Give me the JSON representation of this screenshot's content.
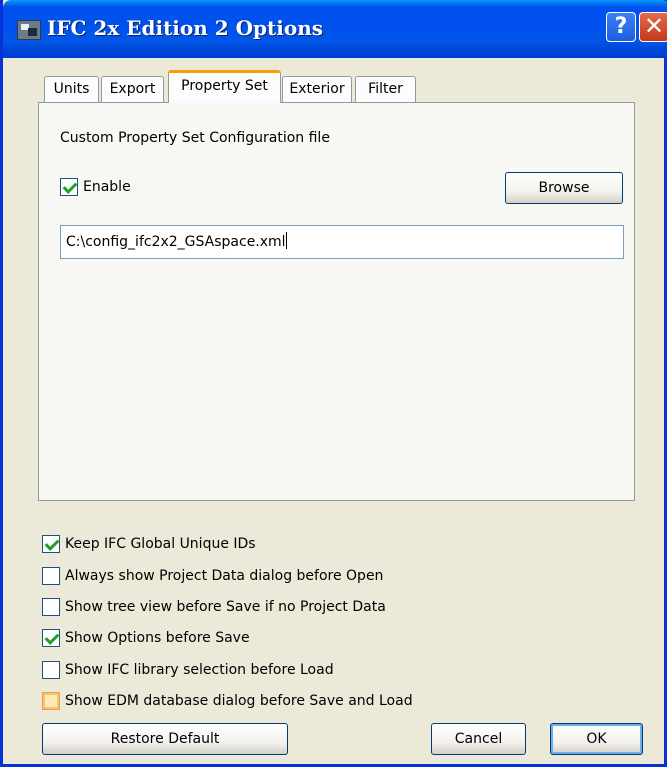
{
  "window": {
    "title": "IFC 2x Edition 2 Options"
  },
  "titlebar": {
    "help_label": "?",
    "close_label": "✕"
  },
  "tabs": [
    {
      "label": "Units"
    },
    {
      "label": "Export"
    },
    {
      "label": "Property Set",
      "active": true
    },
    {
      "label": "Exterior"
    },
    {
      "label": "Filter"
    }
  ],
  "panel": {
    "heading": "Custom Property Set Configuration file",
    "enable_label": "Enable",
    "enable_checked": true,
    "browse_label": "Browse",
    "file_path": "C:\\config_ifc2x2_GSAspace.xml"
  },
  "options": [
    {
      "label": "Keep IFC Global Unique IDs",
      "checked": true
    },
    {
      "label": "Always show Project Data dialog before Open",
      "checked": false
    },
    {
      "label": "Show tree view before Save if no Project Data",
      "checked": false
    },
    {
      "label": "Show Options before Save",
      "checked": true
    },
    {
      "label": "Show IFC library selection before Load",
      "checked": false
    },
    {
      "label": "Show EDM database dialog before Save and Load",
      "checked": false
    }
  ],
  "footer": {
    "restore_label": "Restore Default",
    "cancel_label": "Cancel",
    "ok_label": "OK"
  },
  "colors": {
    "titlebar_blue": "#0053ee",
    "tab_highlight": "#ff9c00",
    "check_green": "#21a121",
    "dialog_face": "#ece9d8"
  }
}
